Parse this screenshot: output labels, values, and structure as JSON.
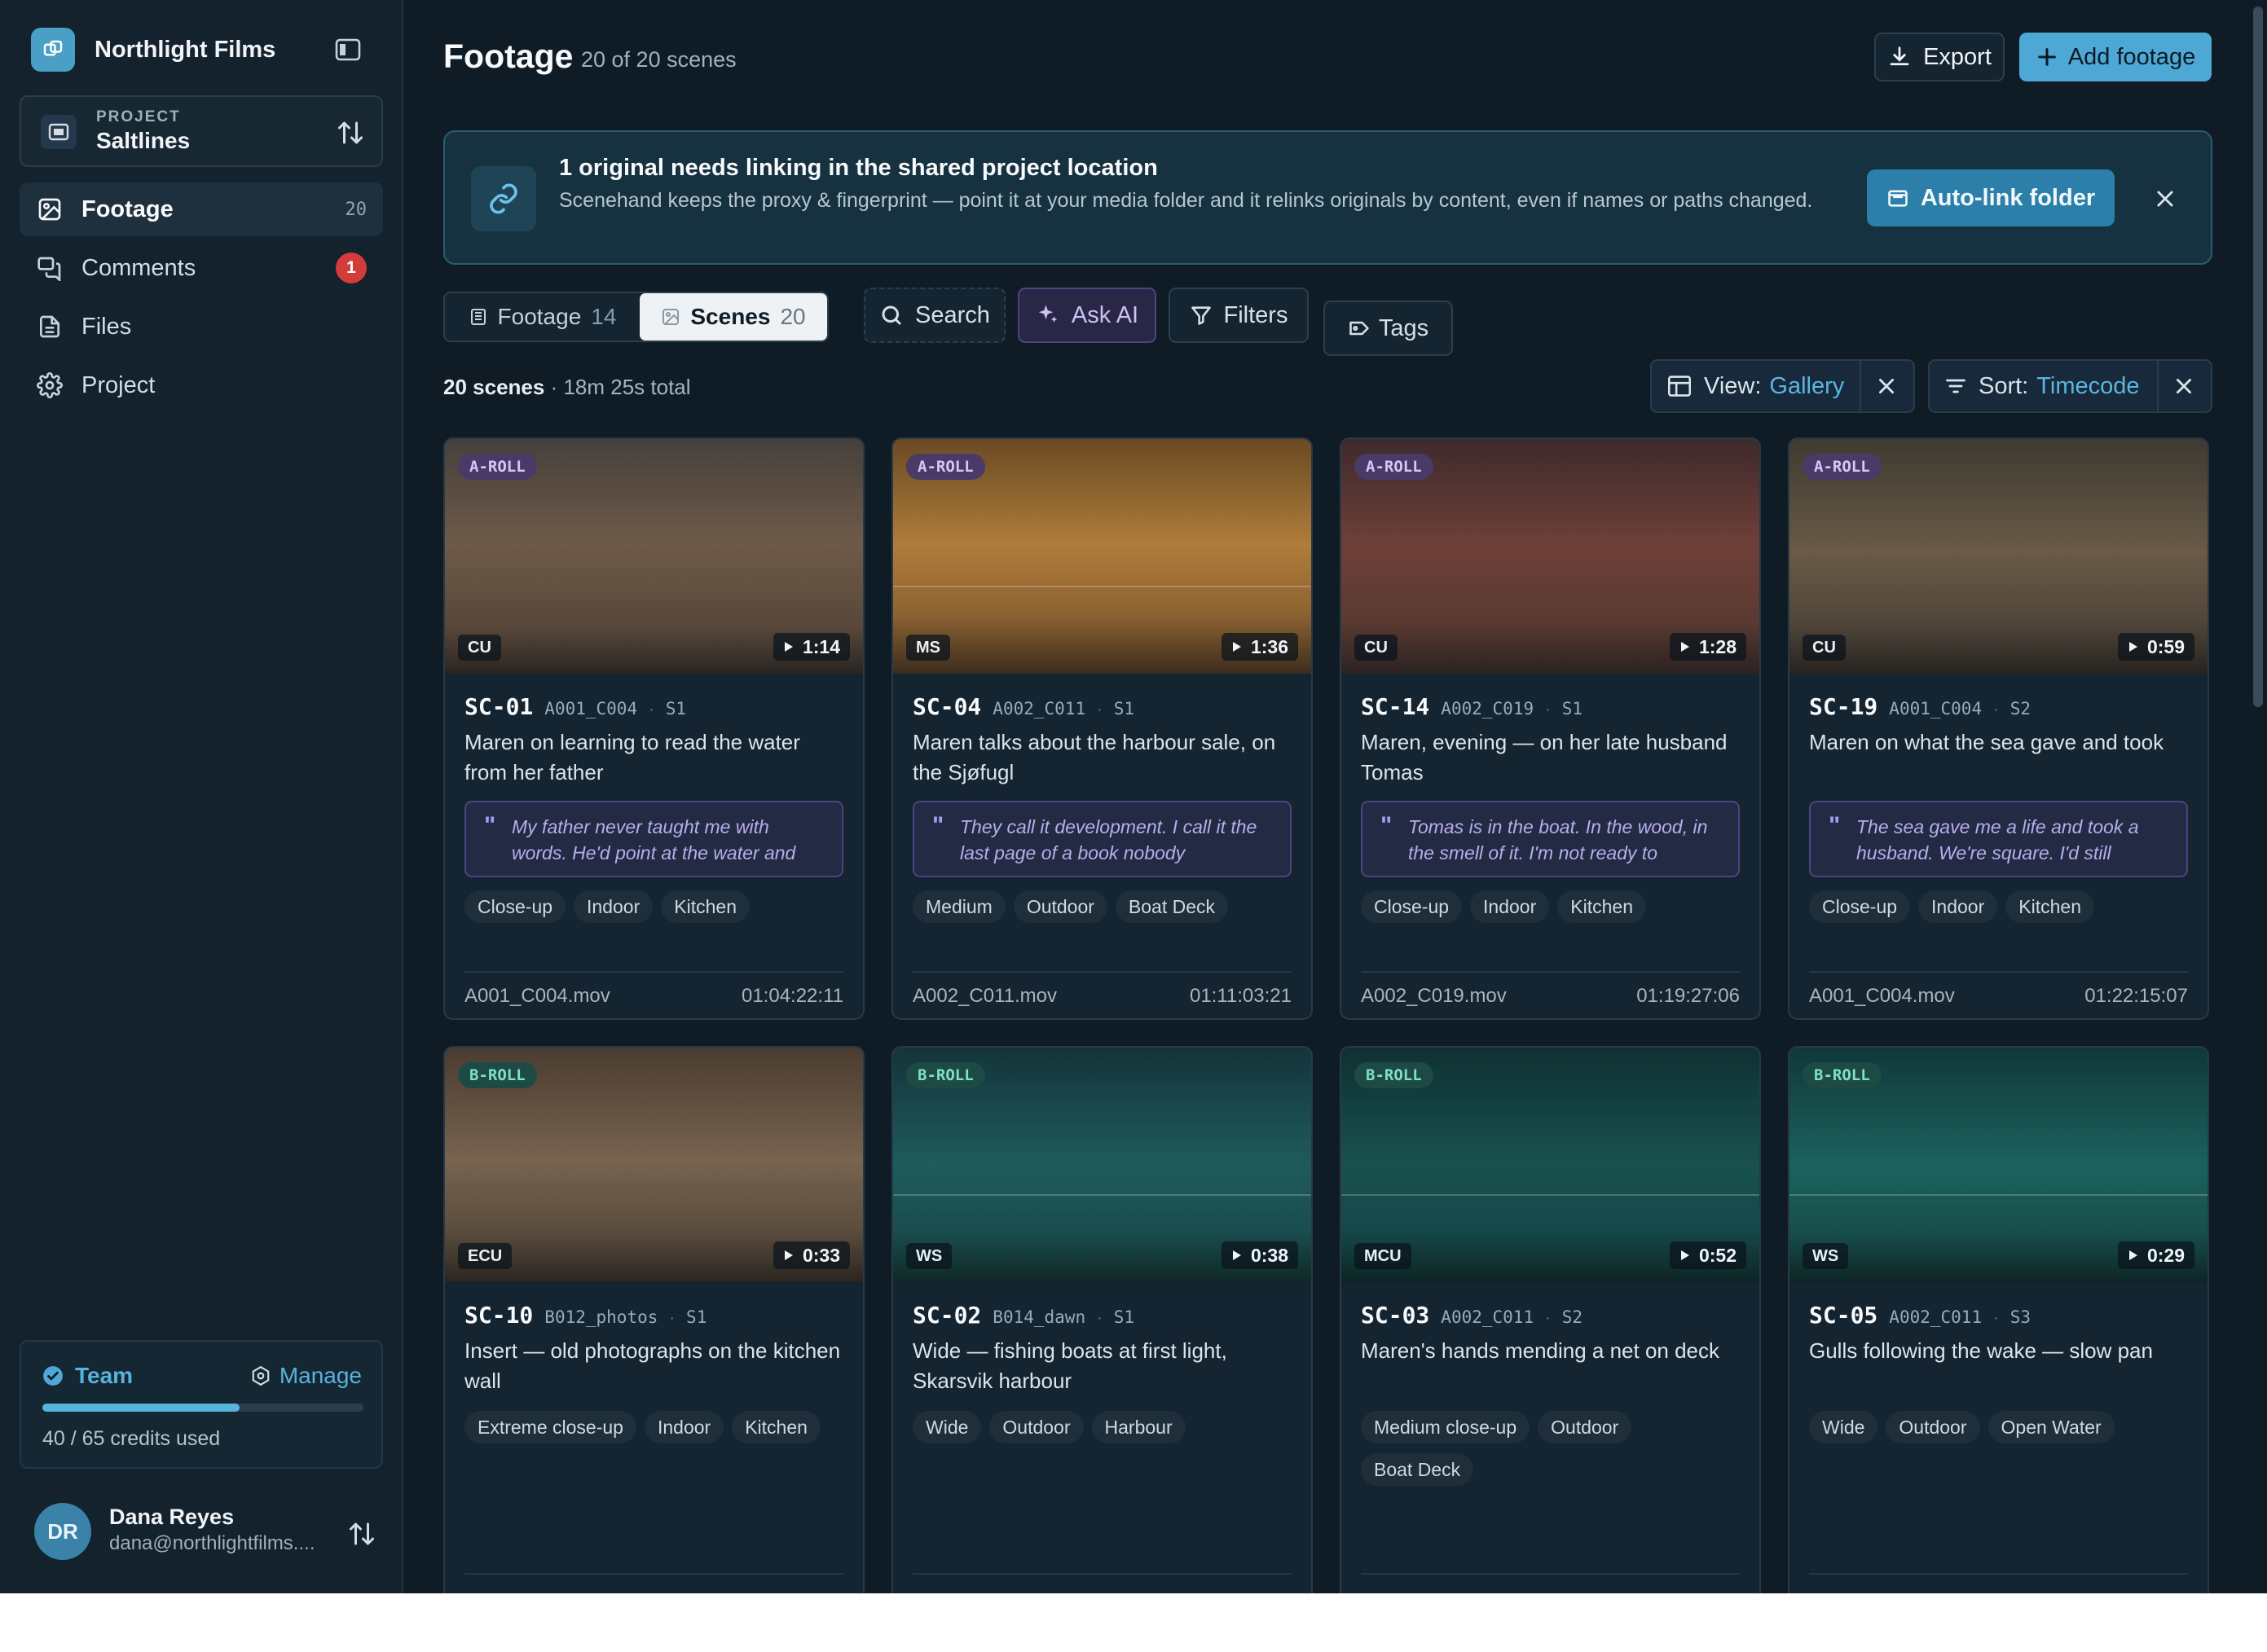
{
  "brand": {
    "name": "Northlight Films"
  },
  "project": {
    "kicker": "PROJECT",
    "name": "Saltlines"
  },
  "nav": [
    {
      "label": "Footage",
      "count": "20",
      "icon": "image-icon",
      "active": true
    },
    {
      "label": "Comments",
      "badge": "1",
      "icon": "comments-icon"
    },
    {
      "label": "Files",
      "icon": "file-icon"
    },
    {
      "label": "Project",
      "icon": "gear-icon"
    }
  ],
  "team": {
    "label": "Team",
    "manage": "Manage",
    "credits_used": 40,
    "credits_total": 65,
    "credits_text": "40 / 65 credits used"
  },
  "user": {
    "initials": "DR",
    "name": "Dana Reyes",
    "email": "dana@northlightfilms...."
  },
  "header": {
    "title": "Footage",
    "subtitle": "20 of 20 scenes",
    "export_label": "Export",
    "add_label": "Add footage"
  },
  "banner": {
    "title": "1 original needs linking in the shared project location",
    "text": "Scenehand keeps the proxy & fingerprint — point it at your media folder and it relinks originals by content, even if names or paths changed.",
    "button": "Auto-link folder"
  },
  "segments": {
    "footage_label": "Footage",
    "footage_count": "14",
    "scenes_label": "Scenes",
    "scenes_count": "20"
  },
  "tools": {
    "search": "Search",
    "ai": "Ask AI",
    "filters": "Filters",
    "tags": "Tags"
  },
  "summary": {
    "count": "20 scenes",
    "total": "· 18m 25s total"
  },
  "view": {
    "label": "View:",
    "value": "Gallery"
  },
  "sort": {
    "label": "Sort:",
    "value": "Timecode"
  },
  "scenes": [
    {
      "roll": "A-ROLL",
      "shot": "CU",
      "duration": "1:14",
      "id": "SC-01",
      "clip": "A001_C004",
      "seq": "S1",
      "title": "Maren on learning to read the water from her father",
      "quote": "My father never taught me with words. He'd point at the water and",
      "tags": [
        "Close-up",
        "Indoor",
        "Kitchen"
      ],
      "file": "A001_C004.mov",
      "timecode": "01:04:22:11"
    },
    {
      "roll": "A-ROLL",
      "shot": "MS",
      "duration": "1:36",
      "id": "SC-04",
      "clip": "A002_C011",
      "seq": "S1",
      "title": "Maren talks about the harbour sale, on the Sjøfugl",
      "quote": "They call it development. I call it the last page of a book nobody",
      "tags": [
        "Medium",
        "Outdoor",
        "Boat Deck"
      ],
      "file": "A002_C011.mov",
      "timecode": "01:11:03:21"
    },
    {
      "roll": "A-ROLL",
      "shot": "CU",
      "duration": "1:28",
      "id": "SC-14",
      "clip": "A002_C019",
      "seq": "S1",
      "title": "Maren, evening — on her late husband Tomas",
      "quote": "Tomas is in the boat. In the wood, in the smell of it. I'm not ready to",
      "tags": [
        "Close-up",
        "Indoor",
        "Kitchen"
      ],
      "file": "A002_C019.mov",
      "timecode": "01:19:27:06"
    },
    {
      "roll": "A-ROLL",
      "shot": "CU",
      "duration": "0:59",
      "id": "SC-19",
      "clip": "A001_C004",
      "seq": "S2",
      "title": "Maren on what the sea gave and took",
      "quote": "The sea gave me a life and took a husband. We're square. I'd still",
      "tags": [
        "Close-up",
        "Indoor",
        "Kitchen"
      ],
      "file": "A001_C004.mov",
      "timecode": "01:22:15:07"
    },
    {
      "roll": "B-ROLL",
      "shot": "ECU",
      "duration": "0:33",
      "id": "SC-10",
      "clip": "B012_photos",
      "seq": "S1",
      "title": "Insert — old photographs on the kitchen wall",
      "tags": [
        "Extreme close-up",
        "Indoor",
        "Kitchen"
      ]
    },
    {
      "roll": "B-ROLL",
      "shot": "WS",
      "duration": "0:38",
      "id": "SC-02",
      "clip": "B014_dawn",
      "seq": "S1",
      "title": "Wide — fishing boats at first light, Skarsvik harbour",
      "tags": [
        "Wide",
        "Outdoor",
        "Harbour"
      ]
    },
    {
      "roll": "B-ROLL",
      "shot": "MCU",
      "duration": "0:52",
      "id": "SC-03",
      "clip": "A002_C011",
      "seq": "S2",
      "title": "Maren's hands mending a net on deck",
      "tags": [
        "Medium close-up",
        "Outdoor",
        "Boat Deck"
      ]
    },
    {
      "roll": "B-ROLL",
      "shot": "WS",
      "duration": "0:29",
      "id": "SC-05",
      "clip": "A002_C011",
      "seq": "S3",
      "title": "Gulls following the wake — slow pan",
      "tags": [
        "Wide",
        "Outdoor",
        "Open Water"
      ]
    }
  ]
}
